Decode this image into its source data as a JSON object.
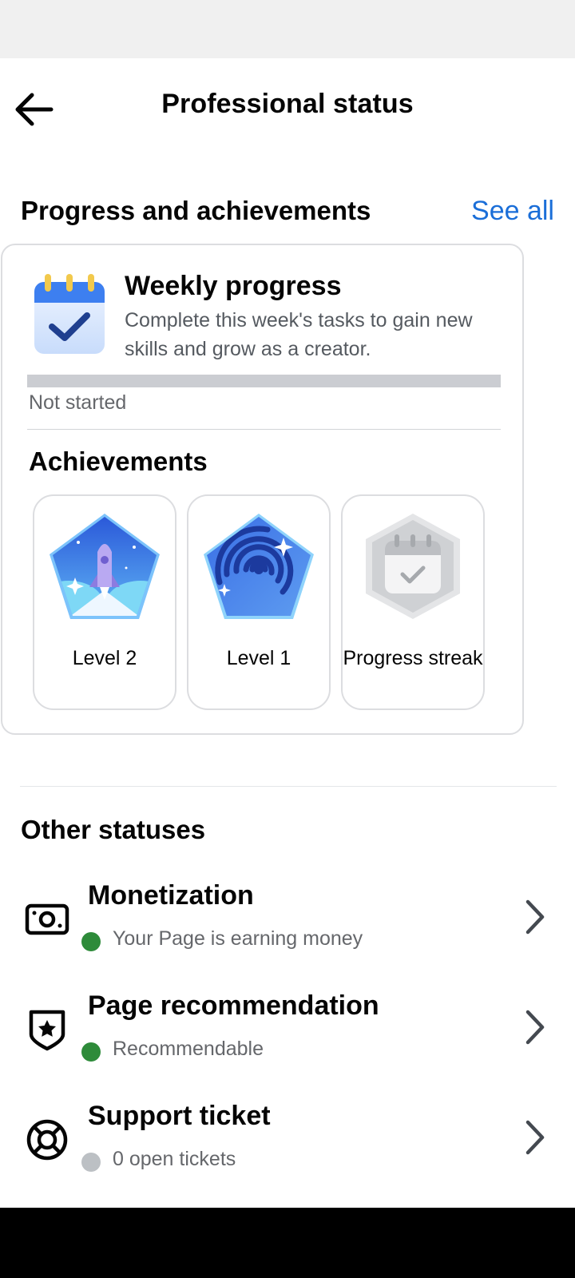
{
  "header": {
    "title": "Professional status"
  },
  "progress_section": {
    "title": "Progress and achievements",
    "see_all": "See all",
    "weekly": {
      "title": "Weekly progress",
      "description": "Complete this week's tasks to gain new skills and grow as a creator.",
      "progress_fraction": 0,
      "status": "Not started"
    },
    "achievements": {
      "title": "Achievements",
      "items": [
        {
          "label": "Level 2"
        },
        {
          "label": "Level 1"
        },
        {
          "label": "Progress streak"
        }
      ]
    }
  },
  "other_statuses": {
    "title": "Other statuses",
    "items": [
      {
        "title": "Monetization",
        "subtitle": "Your Page is earning money",
        "icon": "money-icon",
        "dot_color": "#2e8b3a"
      },
      {
        "title": "Page recommendation",
        "subtitle": "Recommendable",
        "icon": "shield-star-icon",
        "dot_color": "#2e8b3a"
      },
      {
        "title": "Support ticket",
        "subtitle": "0 open tickets",
        "icon": "lifebuoy-icon",
        "dot_color": "#bcc0c4"
      }
    ]
  },
  "colors": {
    "accent": "#1a6ed8",
    "status_green": "#2e8b3a",
    "status_gray": "#bcc0c4"
  }
}
